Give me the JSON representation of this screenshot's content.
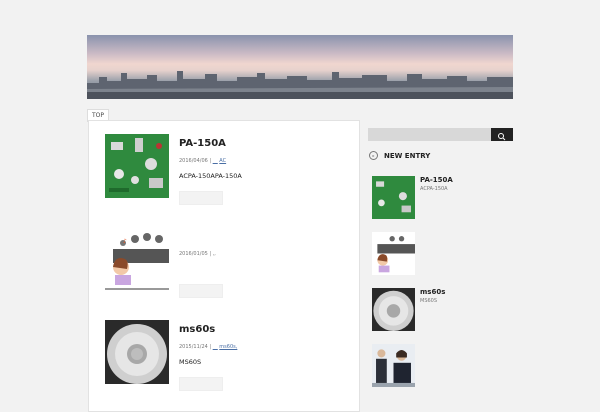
{
  "nav": {
    "top_label": "TOP"
  },
  "posts": [
    {
      "title": "PA-150A",
      "date": "2016/04/06",
      "sep": "|",
      "cat_prefix": "__",
      "cat": "AC",
      "excerpt": "ACPA-150APA-150A"
    },
    {
      "title": "",
      "date": "2016/01/05",
      "sep": "|",
      "cat_prefix": "",
      "cat": ",,",
      "excerpt": ""
    },
    {
      "title": "ms60s",
      "date": "2015/11/24",
      "sep": "|",
      "cat_prefix": "__",
      "cat": "ms60s,",
      "excerpt": "MS60S"
    }
  ],
  "sidebar": {
    "search_placeholder": "",
    "new_entry_title": "NEW ENTRY",
    "entries": [
      {
        "title": "PA-150A",
        "sub": "ACPA-150A"
      },
      {
        "title": "",
        "sub": ""
      },
      {
        "title": "ms60s",
        "sub": "MS60S"
      },
      {
        "title": "",
        "sub": ""
      }
    ]
  },
  "icons": {
    "search": "search-icon",
    "new_entry": "circle-arrow-icon"
  },
  "colors": {
    "background": "#f2f2f2",
    "link": "#4a6fa5",
    "search_button": "#222222",
    "search_field": "#d8d8d8"
  }
}
